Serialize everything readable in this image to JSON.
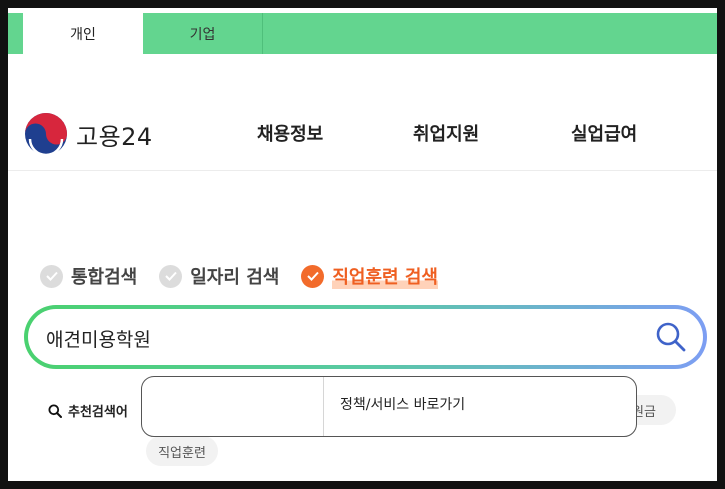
{
  "top_tabs": [
    {
      "label": "개인",
      "active": true
    },
    {
      "label": "기업",
      "active": false
    }
  ],
  "header": {
    "logo_text": "고용24",
    "nav": [
      {
        "label": "채용정보"
      },
      {
        "label": "취업지원"
      },
      {
        "label": "실업급여"
      }
    ]
  },
  "search": {
    "types": [
      {
        "label": "통합검색",
        "selected": false
      },
      {
        "label": "일자리 검색",
        "selected": false
      },
      {
        "label": "직업훈련 검색",
        "selected": true
      }
    ],
    "value": "애견미용학원",
    "icon": "search-icon"
  },
  "recommend": {
    "label": "추천검색어",
    "chips": [
      {
        "label": "원금"
      },
      {
        "label": "직업훈련"
      }
    ]
  },
  "popup": {
    "link_label": "정책/서비스 바로가기"
  },
  "colors": {
    "tab_bar": "#63d58f",
    "accent_orange": "#f26b2b",
    "search_gradient_start": "#4ad16f",
    "search_gradient_end": "#7d9ef3",
    "search_icon": "#3f63c9"
  }
}
